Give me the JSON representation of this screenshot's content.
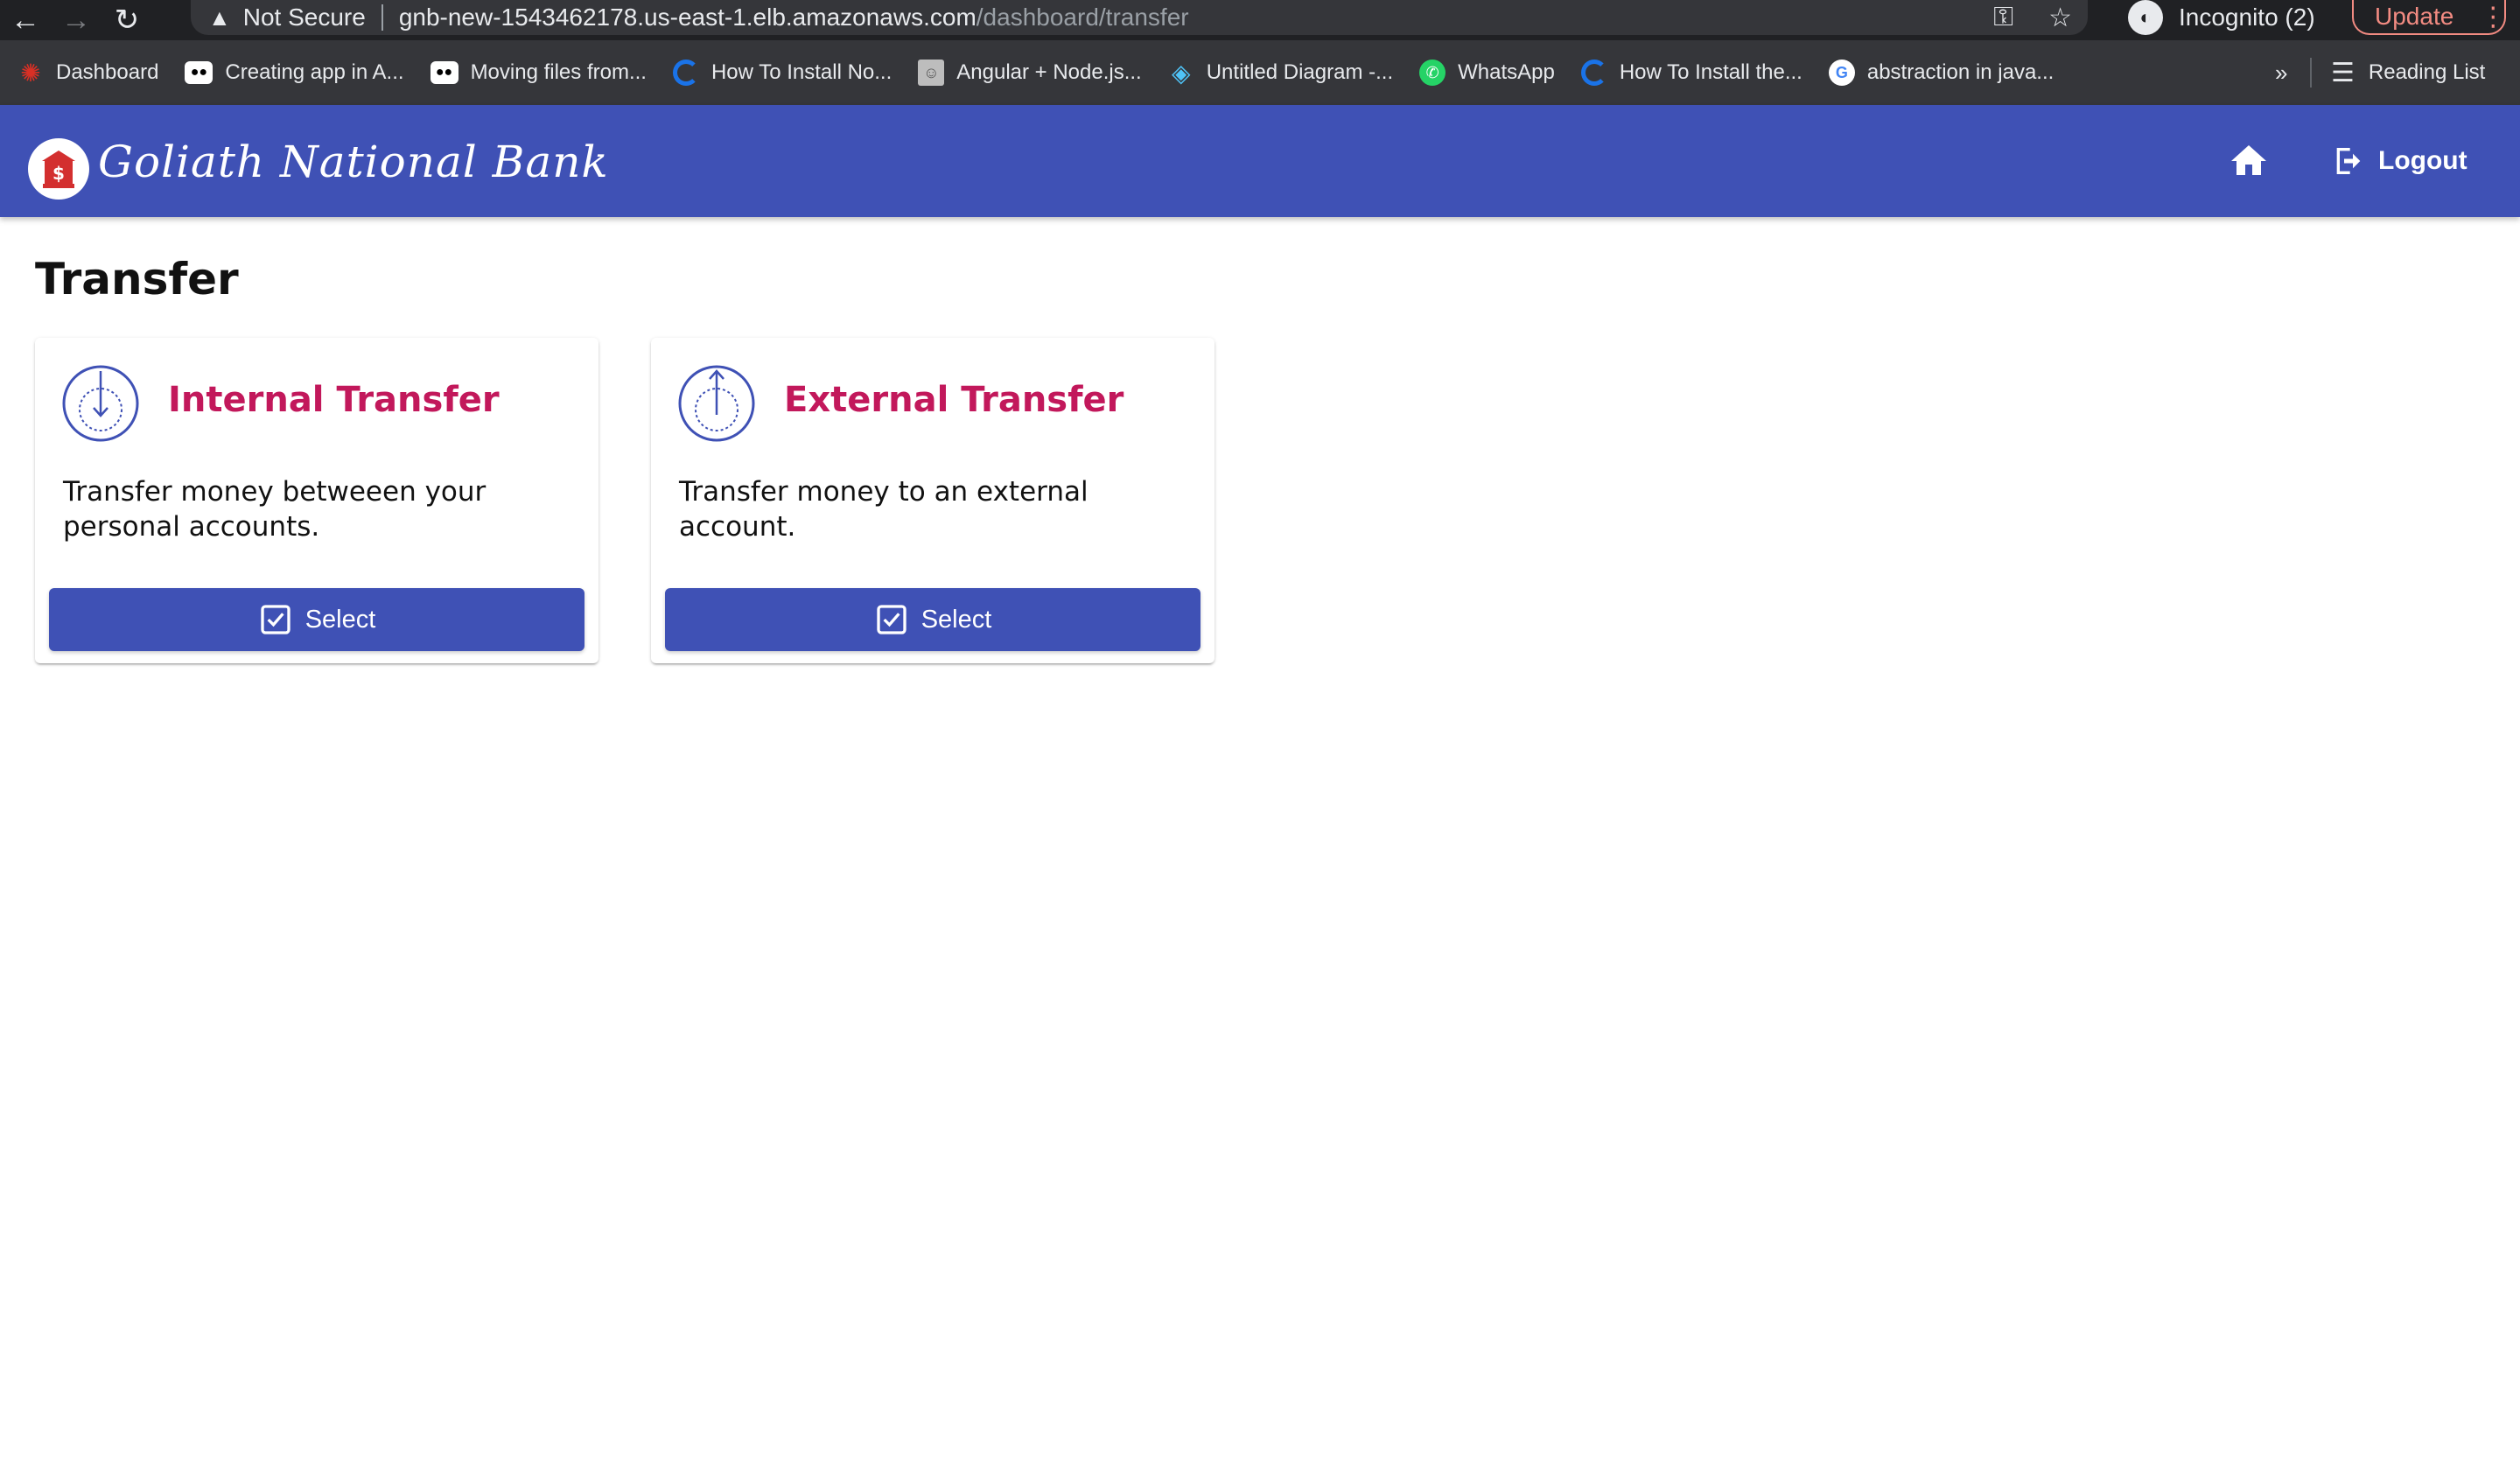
{
  "browser": {
    "security_label": "Not Secure",
    "url_host": "gnb-new-1543462178.us-east-1.elb.amazonaws.com",
    "url_path": "/dashboard/transfer",
    "profile_label": "Incognito (2)",
    "update_label": "Update",
    "bookmarks": [
      {
        "label": "Dashboard",
        "icon": "gear-icon",
        "color": "#d93025"
      },
      {
        "label": "Creating app in A...",
        "icon": "medium-icon",
        "color": "#000000"
      },
      {
        "label": "Moving files from...",
        "icon": "medium-icon",
        "color": "#000000"
      },
      {
        "label": "How To Install No...",
        "icon": "digitalocean-icon",
        "color": "#1a73e8"
      },
      {
        "label": "Angular + Node.js...",
        "icon": "avatar-icon",
        "color": "#9aa0a6"
      },
      {
        "label": "Untitled Diagram -...",
        "icon": "diagram-icon",
        "color": "#4fc3f7"
      },
      {
        "label": "WhatsApp",
        "icon": "whatsapp-icon",
        "color": "#25d366"
      },
      {
        "label": "How To Install the...",
        "icon": "digitalocean-icon",
        "color": "#1a73e8"
      },
      {
        "label": "abstraction in java...",
        "icon": "google-icon",
        "color": "#ffffff"
      }
    ],
    "more_label": "»",
    "reading_list_label": "Reading List"
  },
  "app": {
    "brand": "Goliath National Bank",
    "logout_label": "Logout",
    "header_color": "#3f51b5",
    "accent_color": "#c2185b"
  },
  "page": {
    "title": "Transfer",
    "cards": [
      {
        "title": "Internal Transfer",
        "description": "Transfer money betweeen your personal accounts.",
        "button_label": "Select",
        "icon": "download-icon"
      },
      {
        "title": "External Transfer",
        "description": "Transfer money to an external account.",
        "button_label": "Select",
        "icon": "upload-icon"
      }
    ]
  }
}
